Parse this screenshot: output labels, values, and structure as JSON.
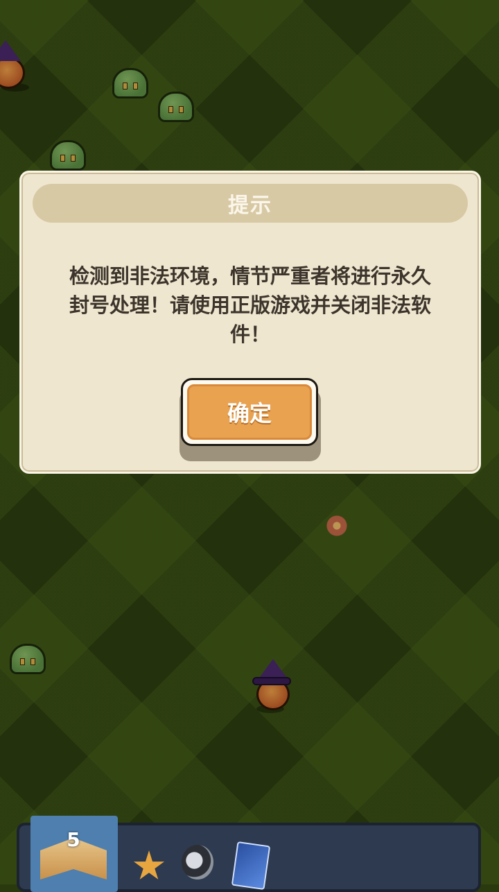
{
  "dialog": {
    "title": "提示",
    "message_line1": "检测到非法环境，情节严重者将进行永久",
    "message_line2": "封号处理！请使用正版游戏并关闭非法软",
    "message_line3": "件！",
    "confirm_label": "确定"
  },
  "bottom_bar": {
    "book_level": "5",
    "items": [
      "book-icon",
      "star-icon",
      "bell-icon",
      "card-icon"
    ]
  },
  "colors": {
    "dialog_bg": "#efe6d0",
    "title_bar": "#d8c9a5",
    "confirm_button": "#e9a24f",
    "grass_dark": "#2e3f10"
  }
}
